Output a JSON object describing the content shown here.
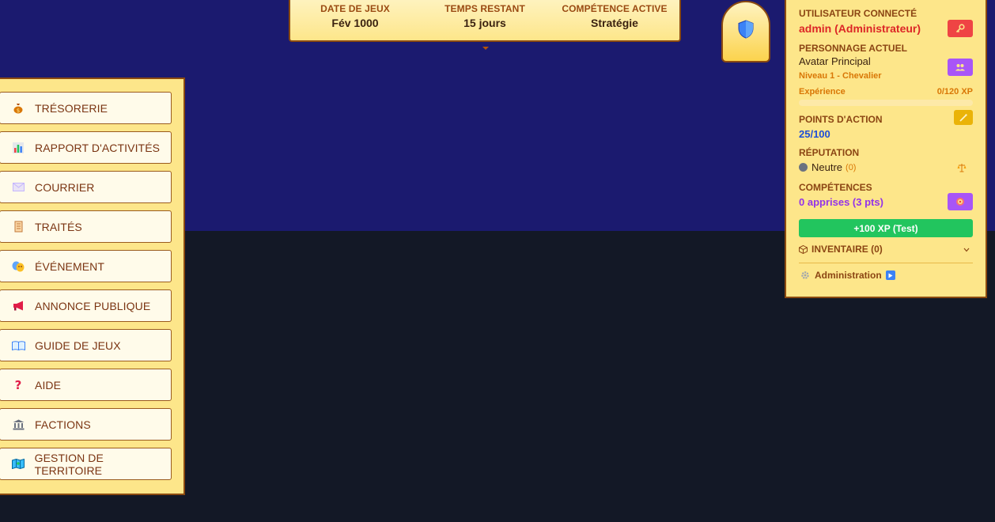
{
  "topbar": {
    "items": [
      {
        "label": "DATE DE JEUX",
        "value": "Fév 1000"
      },
      {
        "label": "TEMPS RESTANT",
        "value": "15 jours"
      },
      {
        "label": "COMPÉTENCE ACTIVE",
        "value": "Stratégie"
      }
    ]
  },
  "menu": {
    "items": [
      {
        "label": "TRÉSORERIE",
        "icon": "money-bag-icon"
      },
      {
        "label": "RAPPORT D'ACTIVITÉS",
        "icon": "bar-chart-icon"
      },
      {
        "label": "COURRIER",
        "icon": "envelope-icon"
      },
      {
        "label": "TRAITÉS",
        "icon": "scroll-icon"
      },
      {
        "label": "ÉVÉNEMENT",
        "icon": "theater-masks-icon"
      },
      {
        "label": "ANNONCE PUBLIQUE",
        "icon": "megaphone-icon"
      },
      {
        "label": "GUIDE DE JEUX",
        "icon": "open-book-icon"
      },
      {
        "label": "AIDE",
        "icon": "question-mark-icon"
      },
      {
        "label": "FACTIONS",
        "icon": "classical-building-icon"
      },
      {
        "label": "GESTION DE TERRITOIRE",
        "icon": "map-icon"
      }
    ]
  },
  "panel": {
    "user_label": "UTILISATEUR CONNECTÉ",
    "user_value": "admin (Administrateur)",
    "char_label": "PERSONNAGE ACTUEL",
    "char_name": "Avatar Principal",
    "char_level": "Niveau 1 - Chevalier",
    "xp_label": "Expérience",
    "xp_value": "0/120 XP",
    "xp_fraction": 0,
    "ap_label": "POINTS D'ACTION",
    "ap_value": "25/100",
    "rep_label": "RÉPUTATION",
    "rep_value": "Neutre",
    "rep_count": "(0)",
    "skills_label": "COMPÉTENCES",
    "skills_value": "0 apprises (3 pts)",
    "xp_test_button": "+100 XP (Test)",
    "inventory_label": "INVENTAIRE (0)",
    "admin_label": "Administration"
  },
  "colors": {
    "header_blue": "#1b1a6f",
    "dark_bg": "#131826",
    "panel_yellow": "#fde68a",
    "border_brown": "#8b4a10",
    "admin_red": "#dc2626",
    "purple": "#a855f7",
    "green": "#22c55e",
    "ap_blue": "#1d4ed8"
  }
}
